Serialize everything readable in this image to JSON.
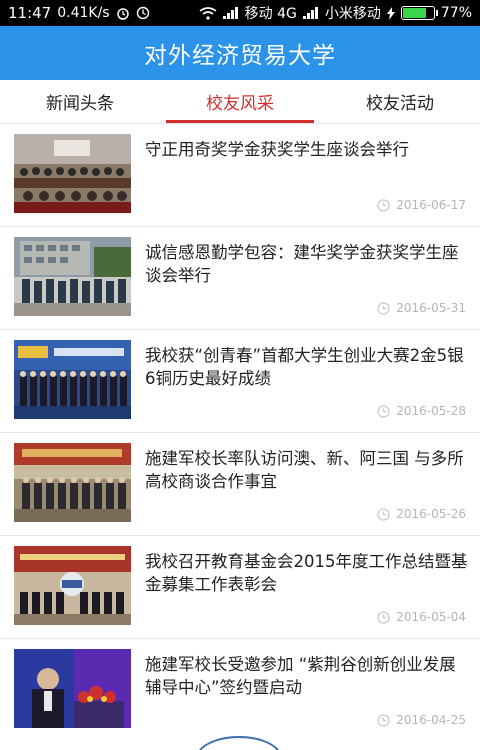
{
  "status_bar": {
    "time": "11:47",
    "speed": "0.41K/s",
    "carrier1": "移动 4G",
    "carrier2": "小米移动",
    "battery": "77%",
    "battery_level": 0.77
  },
  "header": {
    "title": "对外经济贸易大学"
  },
  "tabs": [
    {
      "label": "新闻头条",
      "active": false
    },
    {
      "label": "校友风采",
      "active": true
    },
    {
      "label": "校友活动",
      "active": false
    }
  ],
  "news": [
    {
      "title": "守正用奇奖学金获奖学生座谈会举行",
      "date": "2016-06-17"
    },
    {
      "title": "诚信感恩勤学包容：建华奖学金获奖学生座谈会举行",
      "date": "2016-05-31"
    },
    {
      "title": "我校获“创青春”首都大学生创业大赛2金5银6铜历史最好成绩",
      "date": "2016-05-28"
    },
    {
      "title": "施建军校长率队访问澳、新、阿三国 与多所高校商谈合作事宜",
      "date": "2016-05-26"
    },
    {
      "title": "我校召开教育基金会2015年度工作总结暨基金募集工作表彰会",
      "date": "2016-05-04"
    },
    {
      "title": "施建军校长受邀参加 “紫荆谷创新创业发展辅导中心”签约暨启动",
      "date": "2016-04-25"
    }
  ],
  "colors": {
    "header": "#2c93ea",
    "accent": "#d0312d",
    "date": "#b5b5b5"
  }
}
